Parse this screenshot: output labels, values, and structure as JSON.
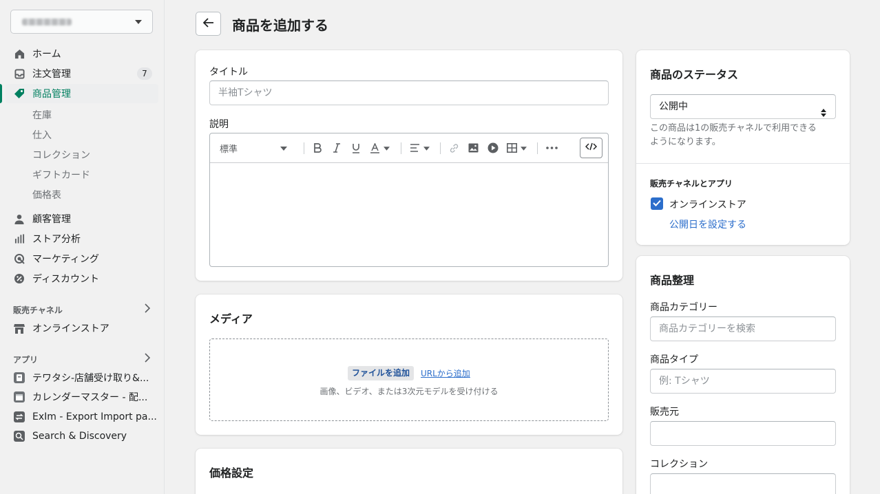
{
  "sidebar": {
    "store_name_obscured": true,
    "nav": [
      {
        "label": "ホーム",
        "icon": "home-icon"
      },
      {
        "label": "注文管理",
        "icon": "inbox-icon",
        "badge": "7"
      },
      {
        "label": "商品管理",
        "icon": "tag-icon",
        "active": true
      }
    ],
    "products_sub": [
      "在庫",
      "仕入",
      "コレクション",
      "ギフトカード",
      "価格表"
    ],
    "nav2": [
      {
        "label": "顧客管理",
        "icon": "person-icon"
      },
      {
        "label": "ストア分析",
        "icon": "bar-chart-icon"
      },
      {
        "label": "マーケティング",
        "icon": "target-icon"
      },
      {
        "label": "ディスカウント",
        "icon": "discount-icon"
      }
    ],
    "sales_channels": {
      "heading": "販売チャネル",
      "items": [
        {
          "label": "オンラインストア",
          "icon": "store-icon"
        }
      ]
    },
    "apps": {
      "heading": "アプリ",
      "items": [
        {
          "label": "テワタシ-店舗受け取り&...",
          "icon": "app-icon"
        },
        {
          "label": "カレンダーマスター - 配...",
          "icon": "calendar-app-icon"
        },
        {
          "label": "ExIm - Export Import pa...",
          "icon": "exim-app-icon"
        },
        {
          "label": "Search & Discovery",
          "icon": "search-discovery-icon"
        }
      ]
    }
  },
  "header": {
    "title": "商品を追加する"
  },
  "product_card": {
    "title_label": "タイトル",
    "title_placeholder": "半袖Tシャツ",
    "description_label": "説明",
    "format_select": "標準"
  },
  "media_card": {
    "title": "メディア",
    "add_file": "ファイルを追加",
    "add_url": "URLから追加",
    "hint": "画像、ビデオ、または3次元モデルを受け付ける"
  },
  "pricing_card": {
    "title": "価格設定"
  },
  "status_card": {
    "title": "商品のステータス",
    "status_value": "公開中",
    "description_line1": "この商品は1の販売チャネルで利用できる",
    "description_line2": "ようになります。",
    "channels_heading": "販売チャネルとアプリ",
    "channel_online": "オンラインストア",
    "set_publish_date": "公開日を設定する"
  },
  "organization_card": {
    "title": "商品整理",
    "category_label": "商品カテゴリー",
    "category_placeholder": "商品カテゴリーを検索",
    "type_label": "商品タイプ",
    "type_placeholder": "例: Tシャツ",
    "vendor_label": "販売元",
    "collection_label": "コレクション"
  },
  "colors": {
    "accent": "#008060",
    "link": "#2c6ecb",
    "checkbox": "#2c6ecb"
  }
}
